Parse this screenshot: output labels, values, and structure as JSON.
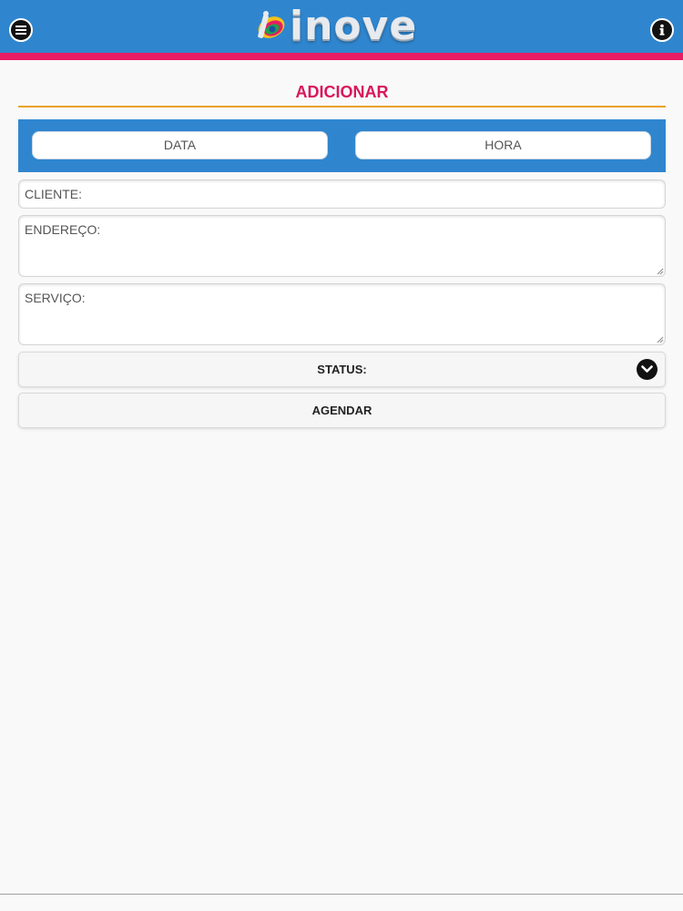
{
  "header": {
    "logo_text": "inove",
    "menu_icon": "menu-icon",
    "info_icon": "info-icon",
    "colors": {
      "bar": "#2f86cf",
      "stripe": "#e81b64"
    }
  },
  "page": {
    "title": "ADICIONAR",
    "title_color": "#d8175a",
    "rule_color": "#eaa128"
  },
  "form": {
    "date_label": "DATA",
    "time_label": "HORA",
    "cliente_placeholder": "CLIENTE:",
    "endereco_placeholder": "ENDEREÇO:",
    "servico_placeholder": "SERVIÇO:",
    "status_label": "STATUS:",
    "status_icon": "chevron-down-icon",
    "submit_label": "AGENDAR"
  }
}
